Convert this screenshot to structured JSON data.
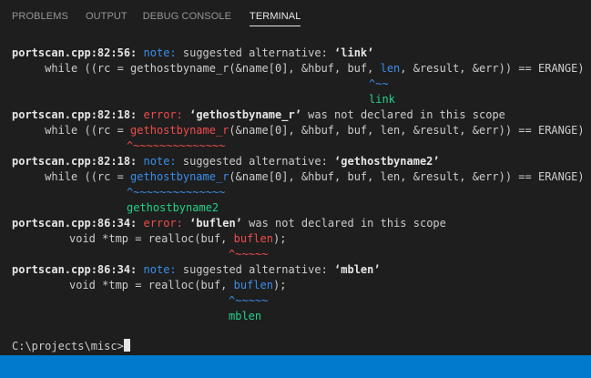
{
  "tabs": [
    {
      "label": "PROBLEMS",
      "active": false
    },
    {
      "label": "OUTPUT",
      "active": false
    },
    {
      "label": "DEBUG CONSOLE",
      "active": false
    },
    {
      "label": "TERMINAL",
      "active": true
    }
  ],
  "terminal": {
    "b1": {
      "loc": "portscan.cpp:82:56:",
      "kind": "note:",
      "msg_pre": " suggested alternative: ",
      "msg_name": "‘link’",
      "code_pre": "while ((rc = gethostbyname_r(&name[0], &hbuf, buf, ",
      "code_hl": "len",
      "code_post": ", &result, &err)) == ERANGE)",
      "caret": "^~~",
      "fix": "link"
    },
    "b2": {
      "loc": "portscan.cpp:82:18:",
      "kind": "error:",
      "msg_pre": " ",
      "msg_name": "‘gethostbyname_r’",
      "msg_post": " was not declared in this scope",
      "code_pre": "while ((rc = ",
      "code_hl": "gethostbyname_r",
      "code_post": "(&name[0], &hbuf, buf, len, &result, &err)) == ERANGE)",
      "caret": "^~~~~~~~~~~~~~~"
    },
    "b3": {
      "loc": "portscan.cpp:82:18:",
      "kind": "note:",
      "msg_pre": " suggested alternative: ",
      "msg_name": "‘gethostbyname2’",
      "code_pre": "while ((rc = ",
      "code_hl": "gethostbyname_r",
      "code_post": "(&name[0], &hbuf, buf, len, &result, &err)) == ERANGE)",
      "caret": "^~~~~~~~~~~~~~~",
      "fix": "gethostbyname2"
    },
    "b4": {
      "loc": "portscan.cpp:86:34:",
      "kind": "error:",
      "msg_pre": " ",
      "msg_name": "‘buflen’",
      "msg_post": " was not declared in this scope",
      "code_pre": "void *tmp = realloc(buf, ",
      "code_hl": "buflen",
      "code_post": ");",
      "caret": "^~~~~~"
    },
    "b5": {
      "loc": "portscan.cpp:86:34:",
      "kind": "note:",
      "msg_pre": " suggested alternative: ",
      "msg_name": "‘mblen’",
      "code_pre": "void *tmp = realloc(buf, ",
      "code_hl": "buflen",
      "code_post": ");",
      "caret": "^~~~~~",
      "fix": "mblen"
    },
    "prompt": "C:\\projects\\misc>"
  },
  "colors": {
    "background": "#1e1e1e",
    "note": "#3b8eea",
    "error": "#f14c4c",
    "fix": "#23d18b",
    "statusbar": "#007acc"
  }
}
